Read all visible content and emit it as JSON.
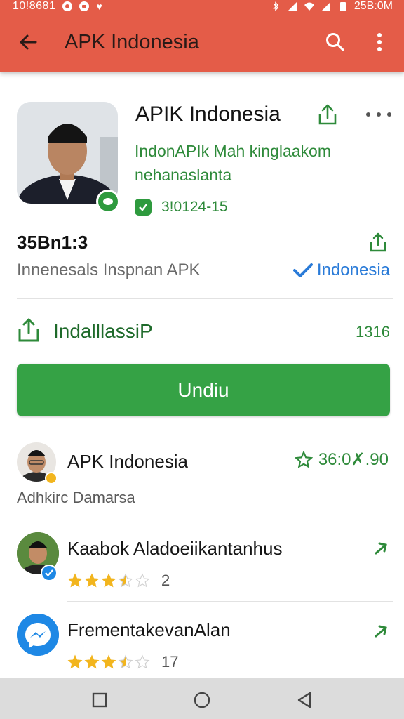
{
  "status_bar": {
    "left_text": "10!8681",
    "right_text": "25B:0M"
  },
  "app_bar": {
    "title": "APK Indonesia"
  },
  "app": {
    "title": "APIK Indonesia",
    "subtitle": "IndonAPIk Mah kinglaakom nehanaslanta",
    "stat": "3!0124-15",
    "size": "35Bn1:3",
    "publisher": "Innenesals Inspnan APK",
    "region": "Indonesia"
  },
  "install": {
    "label": "IndalllassiP",
    "count": "1316"
  },
  "download_button": "Undiu",
  "list": [
    {
      "title": "APK Indonesia",
      "subtitle": "Adhkirc Damarsa",
      "right_value": "36:0✗.90"
    },
    {
      "title": "Kaabok Aladoeiikantanhus",
      "rating": 3.5,
      "rating_count": "2"
    },
    {
      "title": "FrementakevanAlan",
      "rating": 3.5,
      "rating_count": "17"
    }
  ],
  "colors": {
    "app_bar": "#e45c48",
    "accent_green": "#35a245",
    "link_blue": "#2a7bd8",
    "star": "#f2b51e"
  },
  "icons": [
    "back-arrow-icon",
    "search-icon",
    "more-vert-icon",
    "share-icon",
    "more-horiz-icon",
    "verified-icon",
    "check-icon",
    "install-icon",
    "star-outline-icon",
    "star-icon",
    "chevron-icon",
    "messenger-icon",
    "nav-square-icon",
    "nav-circle-icon",
    "nav-triangle-icon"
  ]
}
